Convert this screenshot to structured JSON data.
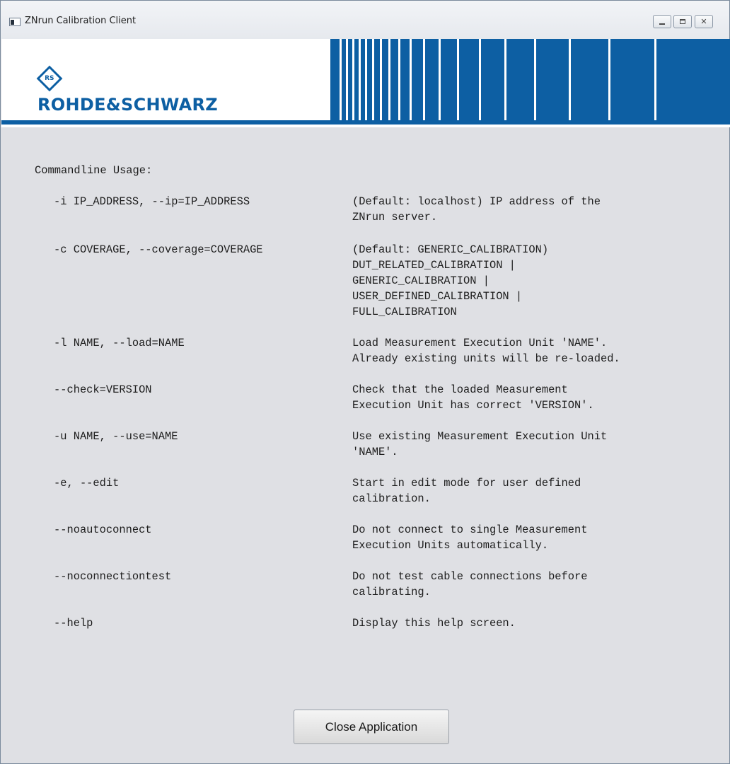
{
  "window": {
    "title": "ZNrun Calibration Client"
  },
  "banner": {
    "logo_mark": "RS",
    "logo_text": "ROHDE&SCHWARZ"
  },
  "help": {
    "heading": "Commandline Usage:",
    "options": [
      {
        "flag": "-i IP_ADDRESS, --ip=IP_ADDRESS",
        "desc": "(Default: localhost) IP address of the\nZNrun server."
      },
      {
        "flag": "-c COVERAGE, --coverage=COVERAGE",
        "desc": "(Default: GENERIC_CALIBRATION)\nDUT_RELATED_CALIBRATION |\nGENERIC_CALIBRATION |\nUSER_DEFINED_CALIBRATION |\nFULL_CALIBRATION"
      },
      {
        "flag": "-l NAME, --load=NAME",
        "desc": "Load Measurement Execution Unit 'NAME'.\nAlready existing units will be re-loaded."
      },
      {
        "flag": "--check=VERSION",
        "desc": "Check that the loaded Measurement\nExecution Unit has correct 'VERSION'."
      },
      {
        "flag": "-u NAME, --use=NAME",
        "desc": "Use existing Measurement Execution Unit\n'NAME'."
      },
      {
        "flag": "-e, --edit",
        "desc": "Start in edit mode for user defined\ncalibration."
      },
      {
        "flag": "--noautoconnect",
        "desc": "Do not connect to single Measurement\nExecution Units automatically."
      },
      {
        "flag": "--noconnectiontest",
        "desc": "Do not test cable connections before\ncalibrating."
      },
      {
        "flag": "--help",
        "desc": "Display this help screen."
      }
    ]
  },
  "buttons": {
    "close_application": "Close Application",
    "close_glyph": "✕"
  },
  "colors": {
    "brand_blue": "#0d5fa3",
    "window_bg": "#dfe0e4"
  }
}
